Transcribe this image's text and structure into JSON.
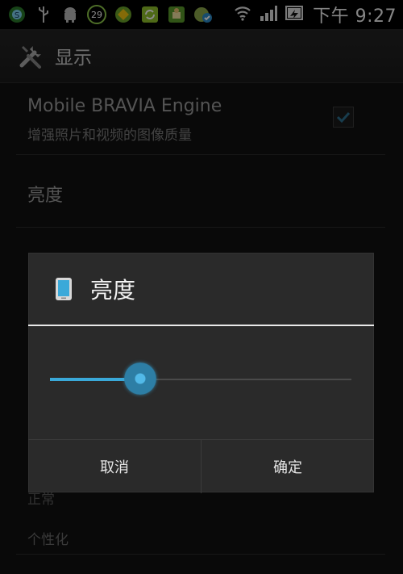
{
  "status_bar": {
    "time": "下午 9:27",
    "notification_count": "29",
    "icons": [
      "browser-icon",
      "usb-icon",
      "android-debug-icon",
      "calendar-badge-icon",
      "app-diamond-icon",
      "sync-icon",
      "app-store-icon",
      "app-check-icon"
    ],
    "right_icons": [
      "wifi-icon",
      "signal-icon",
      "battery-icon"
    ]
  },
  "action_bar": {
    "title": "显示",
    "icon": "tools-icon"
  },
  "settings": {
    "bravia_title": "Mobile BRAVIA Engine",
    "bravia_summary": "增强照片和视频的图像质量",
    "bravia_checked": true,
    "brightness_title": "亮度",
    "partial_label_1": "正常",
    "partial_label_2": "个性化"
  },
  "dialog": {
    "title": "亮度",
    "icon": "phone-icon",
    "slider_value": 0.3,
    "cancel_label": "取消",
    "ok_label": "确定"
  },
  "colors": {
    "accent": "#3aa9d9",
    "dialog_bg": "#2a2a2a",
    "background": "#111111"
  }
}
